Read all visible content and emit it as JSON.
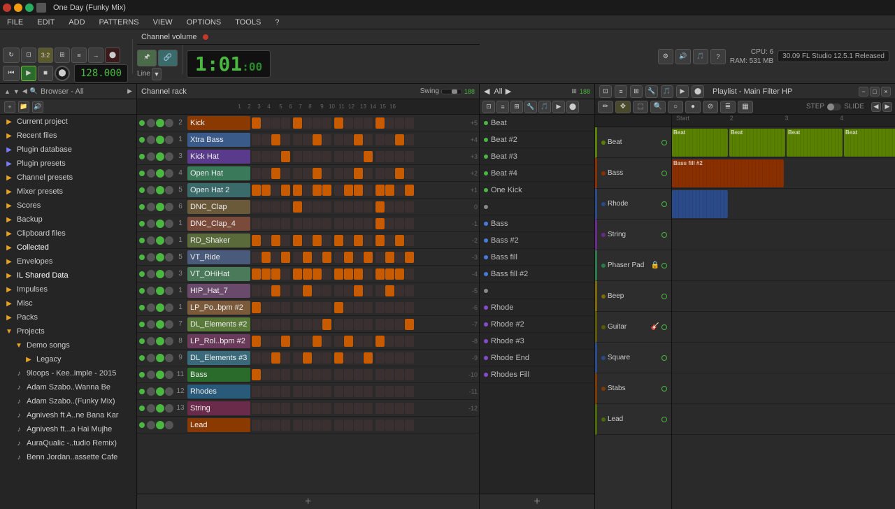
{
  "titleBar": {
    "title": "One Day (Funky Mix)",
    "closeLabel": "×",
    "minLabel": "−",
    "maxLabel": "□"
  },
  "menuBar": {
    "items": [
      "FILE",
      "EDIT",
      "ADD",
      "PATTERNS",
      "VIEW",
      "OPTIONS",
      "TOOLS",
      "?"
    ]
  },
  "toolbar": {
    "bpm": "128.000",
    "time": "1:01",
    "timeBeats": "00",
    "timeBar": "1",
    "channelVolume": "Channel volume",
    "lineLabel": "Line",
    "pattern": "3:2",
    "flVersion": "30.09  FL Studio 12.5.1 Released",
    "cpu": "6",
    "ram": "531 MB"
  },
  "browser": {
    "title": "Browser - All",
    "items": [
      {
        "label": "Current project",
        "icon": "▶",
        "type": "folder",
        "indent": 0
      },
      {
        "label": "Recent files",
        "icon": "▶",
        "type": "folder",
        "indent": 0
      },
      {
        "label": "Plugin database",
        "icon": "▶",
        "type": "plugin",
        "indent": 0
      },
      {
        "label": "Plugin presets",
        "icon": "▶",
        "type": "plugin",
        "indent": 0
      },
      {
        "label": "Channel presets",
        "icon": "▶",
        "type": "folder",
        "indent": 0
      },
      {
        "label": "Mixer presets",
        "icon": "▶",
        "type": "folder",
        "indent": 0
      },
      {
        "label": "Scores",
        "icon": "▶",
        "type": "folder",
        "indent": 0
      },
      {
        "label": "Backup",
        "icon": "▶",
        "type": "folder",
        "indent": 0
      },
      {
        "label": "Clipboard files",
        "icon": "▶",
        "type": "folder",
        "indent": 0
      },
      {
        "label": "Collected",
        "icon": "▶",
        "type": "folder",
        "indent": 0
      },
      {
        "label": "Envelopes",
        "icon": "▶",
        "type": "folder",
        "indent": 0
      },
      {
        "label": "IL Shared Data",
        "icon": "▶",
        "type": "folder",
        "indent": 0
      },
      {
        "label": "Impulses",
        "icon": "▶",
        "type": "folder",
        "indent": 0
      },
      {
        "label": "Misc",
        "icon": "▶",
        "type": "folder",
        "indent": 0
      },
      {
        "label": "Packs",
        "icon": "▶",
        "type": "folder",
        "indent": 0
      },
      {
        "label": "Projects",
        "icon": "▼",
        "type": "folder-open",
        "indent": 0
      },
      {
        "label": "Demo songs",
        "icon": "▼",
        "type": "folder-open",
        "indent": 1
      },
      {
        "label": "Legacy",
        "icon": "▶",
        "type": "folder",
        "indent": 2
      },
      {
        "label": "9loops - Kee..imple - 2015",
        "icon": "♪",
        "type": "file",
        "indent": 1
      },
      {
        "label": "Adam Szabo..Wanna Be",
        "icon": "♪",
        "type": "file",
        "indent": 1
      },
      {
        "label": "Adam Szabo..(Funky Mix)",
        "icon": "♪",
        "type": "file",
        "indent": 1
      },
      {
        "label": "Agnivesh ft A..ne Bana Kar",
        "icon": "♪",
        "type": "file",
        "indent": 1
      },
      {
        "label": "Agnivesh ft...a Hai Mujhe",
        "icon": "♪",
        "type": "file",
        "indent": 1
      },
      {
        "label": "AuraQualic -..tudio Remix)",
        "icon": "♪",
        "type": "file",
        "indent": 1
      },
      {
        "label": "Benn Jordan..assette Cafe",
        "icon": "♪",
        "type": "file",
        "indent": 1
      }
    ]
  },
  "channelRack": {
    "title": "Channel rack",
    "swingLabel": "Swing",
    "channels": [
      {
        "num": "2",
        "name": "Kick",
        "colorClass": "cn-kick"
      },
      {
        "num": "1",
        "name": "Xtra Bass",
        "colorClass": "cn-xtra"
      },
      {
        "num": "3",
        "name": "Kick Hat",
        "colorClass": "cn-kickhat"
      },
      {
        "num": "4",
        "name": "Open Hat",
        "colorClass": "cn-openhat"
      },
      {
        "num": "5",
        "name": "Open Hat 2",
        "colorClass": "cn-openhat2"
      },
      {
        "num": "6",
        "name": "DNC_Clap",
        "colorClass": "cn-dnc"
      },
      {
        "num": "1",
        "name": "DNC_Clap_4",
        "colorClass": "cn-dnc4"
      },
      {
        "num": "1",
        "name": "RD_Shaker",
        "colorClass": "cn-rd"
      },
      {
        "num": "5",
        "name": "VT_Ride",
        "colorClass": "cn-vt"
      },
      {
        "num": "3",
        "name": "VT_OHiHat",
        "colorClass": "cn-vt2"
      },
      {
        "num": "1",
        "name": "HIP_Hat_7",
        "colorClass": "cn-hip"
      },
      {
        "num": "1",
        "name": "LP_Po..bpm #2",
        "colorClass": "cn-lp"
      },
      {
        "num": "7",
        "name": "DL_Elements #2",
        "colorClass": "cn-dl"
      },
      {
        "num": "8",
        "name": "LP_Rol..bpm #2",
        "colorClass": "cn-lp2"
      },
      {
        "num": "9",
        "name": "DL_Elements #3",
        "colorClass": "cn-dl2"
      },
      {
        "num": "11",
        "name": "Bass",
        "colorClass": "cn-bass"
      },
      {
        "num": "12",
        "name": "Rhodes",
        "colorClass": "cn-rhodes"
      },
      {
        "num": "13",
        "name": "String",
        "colorClass": "cn-string"
      },
      {
        "num": "",
        "name": "Lead",
        "colorClass": "cn-kick"
      }
    ]
  },
  "patternList": {
    "title": "All",
    "patterns": [
      {
        "label": "Beat",
        "bulletClass": "green"
      },
      {
        "label": "Beat #2",
        "bulletClass": "green"
      },
      {
        "label": "Beat #3",
        "bulletClass": "green"
      },
      {
        "label": "Beat #4",
        "bulletClass": "green"
      },
      {
        "label": "One Kick",
        "bulletClass": "green"
      },
      {
        "label": "",
        "bulletClass": "dot"
      },
      {
        "label": "Bass",
        "bulletClass": "blue"
      },
      {
        "label": "Bass #2",
        "bulletClass": "blue"
      },
      {
        "label": "Bass fill",
        "bulletClass": "blue"
      },
      {
        "label": "Bass fill #2",
        "bulletClass": "blue"
      },
      {
        "label": "",
        "bulletClass": "dot"
      },
      {
        "label": "Rhode",
        "bulletClass": "purple"
      },
      {
        "label": "Rhode #2",
        "bulletClass": "purple"
      },
      {
        "label": "Rhode #3",
        "bulletClass": "purple"
      },
      {
        "label": "Rhode End",
        "bulletClass": "purple"
      },
      {
        "label": "Rhodes Fill",
        "bulletClass": "purple"
      }
    ]
  },
  "playlist": {
    "title": "Playlist - Main Filter HP",
    "tracks": [
      {
        "name": "Beat",
        "colorClass": "tc-beat"
      },
      {
        "name": "Bass",
        "colorClass": "tc-bass"
      },
      {
        "name": "Rhode",
        "colorClass": "tc-rhode"
      },
      {
        "name": "String",
        "colorClass": "tc-string"
      },
      {
        "name": "Phaser Pad",
        "colorClass": "tc-phaser"
      },
      {
        "name": "Beep",
        "colorClass": "tc-beep"
      },
      {
        "name": "Guitar",
        "colorClass": "tc-guitar"
      },
      {
        "name": "Square",
        "colorClass": "tc-square"
      },
      {
        "name": "Stabs",
        "colorClass": "tc-stabs"
      },
      {
        "name": "Lead",
        "colorClass": "tc-lead"
      }
    ],
    "rulerMarks": [
      "Start",
      "2",
      "3",
      "4"
    ]
  },
  "stepNumbers": [
    "+5",
    "+4",
    "+3",
    "+2",
    "+1",
    "0",
    "-1",
    "-2",
    "-3",
    "-4",
    "-5",
    "-6",
    "-7",
    "-8",
    "-9",
    "-10",
    "-11",
    "-12"
  ]
}
